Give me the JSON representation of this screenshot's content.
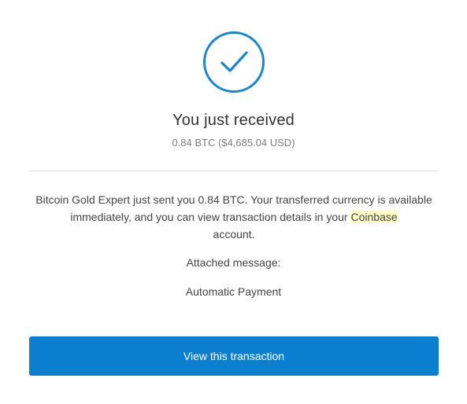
{
  "status_icon": "check-circle-icon",
  "accent_color": "#0a7fd0",
  "header": {
    "title": "You just received",
    "amount": "0.84 BTC ($4,685.04 USD)"
  },
  "body": {
    "message_before_link": "Bitcoin Gold Expert just sent you 0.84 BTC. Your transferred currency is available immediately, and you can view transaction details in your ",
    "brand_word": "Coinbase",
    "message_after_link": " account.",
    "attached_label": "Attached message:",
    "attached_message": "Automatic Payment"
  },
  "actions": {
    "view_transaction_label": "View this transaction"
  }
}
